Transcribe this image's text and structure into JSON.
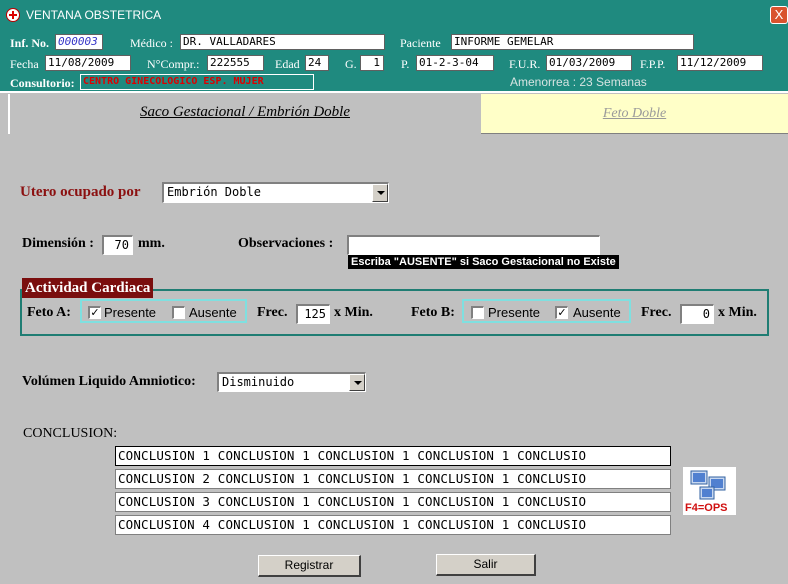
{
  "window": {
    "title": "VENTANA OBSTETRICA",
    "close": "X"
  },
  "header": {
    "inf_no_label": "Inf. No.",
    "inf_no": "000003",
    "medico_label": "Médico :",
    "medico": "DR. VALLADARES",
    "paciente_label": "Paciente",
    "paciente": "INFORME GEMELAR",
    "fecha_label": "Fecha",
    "fecha": "11/08/2009",
    "ncompr_label": "N°Compr.:",
    "ncompr": "222555",
    "edad_label": "Edad",
    "edad": "24",
    "g_label": "G.",
    "g": "1",
    "p_label": "P.",
    "p": "01-2-3-04",
    "fur_label": "F.U.R.",
    "fur": "01/03/2009",
    "fpp_label": "F.P.P.",
    "fpp": "11/12/2009",
    "consultorio_label": "Consultorio:",
    "consultorio": "CENTRO GINECOLOGICO ESP. MUJER",
    "amenorrea": "Amenorrea : 23 Semanas"
  },
  "tabs": [
    {
      "label": "Saco Gestacional / Embrión Doble",
      "active": true
    },
    {
      "label": "Feto Doble",
      "active": false
    }
  ],
  "form": {
    "utero_label": "Utero ocupado por",
    "utero_value": "Embrión Doble",
    "dimension_label": "Dimensión :",
    "dimension_value": "70",
    "dimension_unit": "mm.",
    "observaciones_label": "Observaciones :",
    "observaciones_value": "",
    "hint": "Escriba \"AUSENTE\" si Saco Gestacional no Existe",
    "actividad_label": "Actividad Cardiaca",
    "feto_a_label": "Feto A:",
    "feto_a_presente": true,
    "feto_a_ausente": false,
    "presente_label": "Presente",
    "ausente_label": "Ausente",
    "frec_label": "Frec.",
    "feto_a_frec": "125",
    "xmin_label": "x Min.",
    "feto_b_label": "Feto B:",
    "feto_b_presente": false,
    "feto_b_ausente": true,
    "feto_b_frec": "0",
    "liquido_label": "Volúmen Liquido Amniotico:",
    "liquido_value": "Disminuido",
    "conclusion_label": "CONCLUSION:",
    "conclusions": [
      "CONCLUSION 1 CONCLUSION 1 CONCLUSION 1 CONCLUSION 1 CONCLUSIO",
      "CONCLUSION 2 CONCLUSION 1 CONCLUSION 1 CONCLUSION 1 CONCLUSIO",
      "CONCLUSION 3 CONCLUSION 1 CONCLUSION 1 CONCLUSION 1 CONCLUSIO",
      "CONCLUSION 4 CONCLUSION 1 CONCLUSION 1 CONCLUSION 1 CONCLUSIO"
    ],
    "f4_label": "F4=OPS"
  },
  "buttons": {
    "registrar": "Registrar",
    "salir": "Salir"
  },
  "colors": {
    "header_bg": "#1f8a7f",
    "legend_bg": "#7a0e0e",
    "label_red": "#8b1010",
    "inactive_tab": "#ffffc8"
  }
}
